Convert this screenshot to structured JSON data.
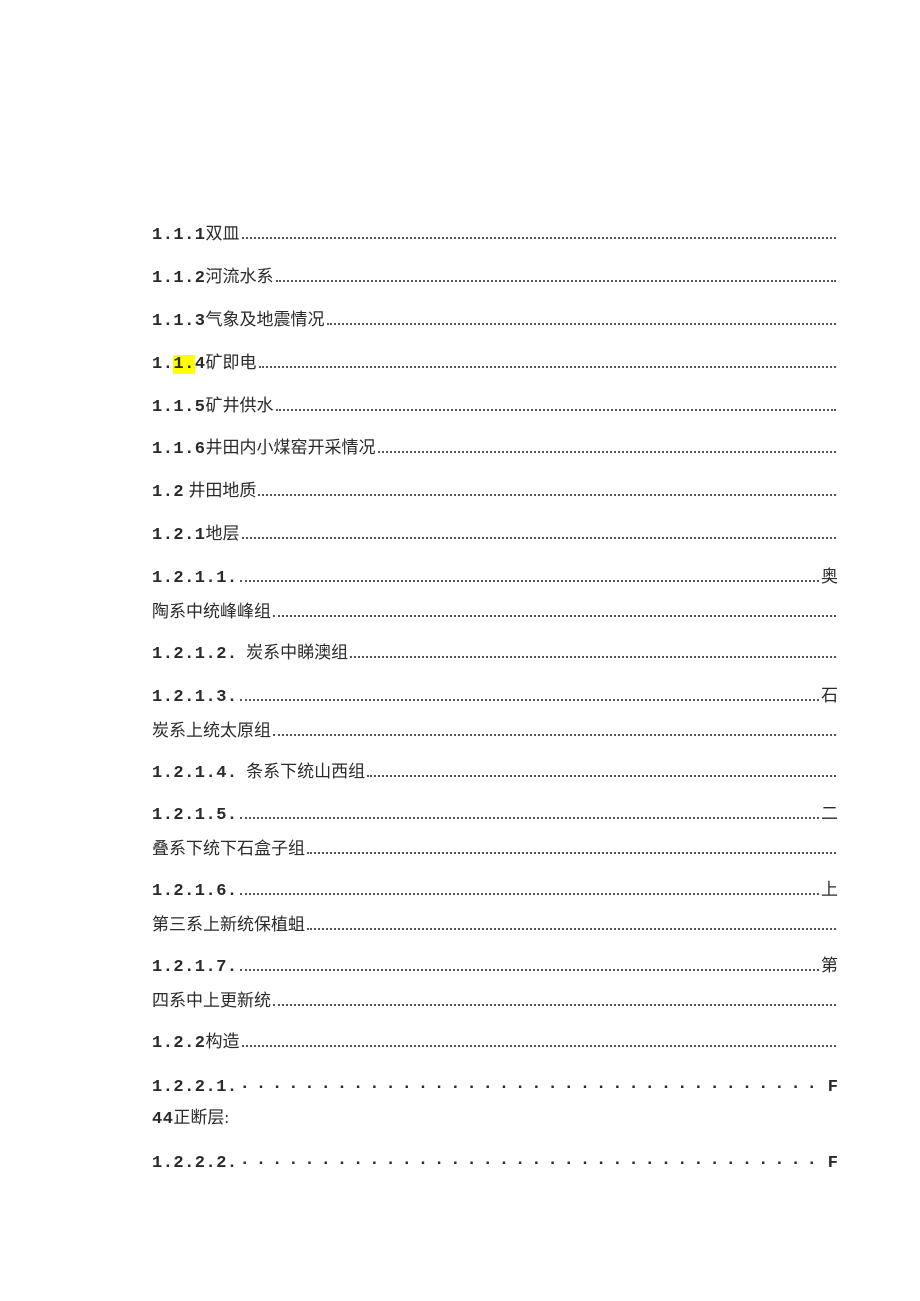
{
  "toc": [
    {
      "num": "1.1.1",
      "title": "双皿"
    },
    {
      "num": "1.1.2",
      "title": "河流水系"
    },
    {
      "num": "1.1.3",
      "title": "气象及地震情况"
    },
    {
      "num": "1.1.4",
      "title": "矿即电",
      "hl_start": 2,
      "hl_end": 4
    },
    {
      "num": "1.1.5",
      "title": "矿井供水"
    },
    {
      "num": "1.1.6",
      "title": "井田内小煤窑开采情况"
    },
    {
      "num": "1.2",
      "title": " 井田地质"
    },
    {
      "num": "1.2.1",
      "title": "地层"
    },
    {
      "num": "1.2.1.1.",
      "title": "",
      "tail": "奥",
      "cont": "陶系中统峰峰组"
    },
    {
      "num": "1.2.1.2.",
      "title": "  炭系中睇澳组"
    },
    {
      "num": "1.2.1.3.",
      "title": "",
      "tail": "石",
      "cont": "炭系上统太原组"
    },
    {
      "num": "1.2.1.4.",
      "title": "  条系下统山西组"
    },
    {
      "num": "1.2.1.5.",
      "title": "",
      "tail": "二",
      "cont": "叠系下统下石盒子组"
    },
    {
      "num": "1.2.1.6.",
      "title": "",
      "tail": "上",
      "cont": "第三系上新统保植蛆"
    },
    {
      "num": "1.2.1.7.",
      "title": "",
      "tail": "第",
      "cont": "四系中上更新统"
    },
    {
      "num": "1.2.2",
      "title": "构造"
    },
    {
      "num": "1.2.2.1.",
      "title": "",
      "tail_mono": "F",
      "sparse": true,
      "sub": "44",
      "sub_text": "正断层:"
    },
    {
      "num": "1.2.2.2.",
      "title": "",
      "tail_mono": "F",
      "sparse": true
    }
  ]
}
